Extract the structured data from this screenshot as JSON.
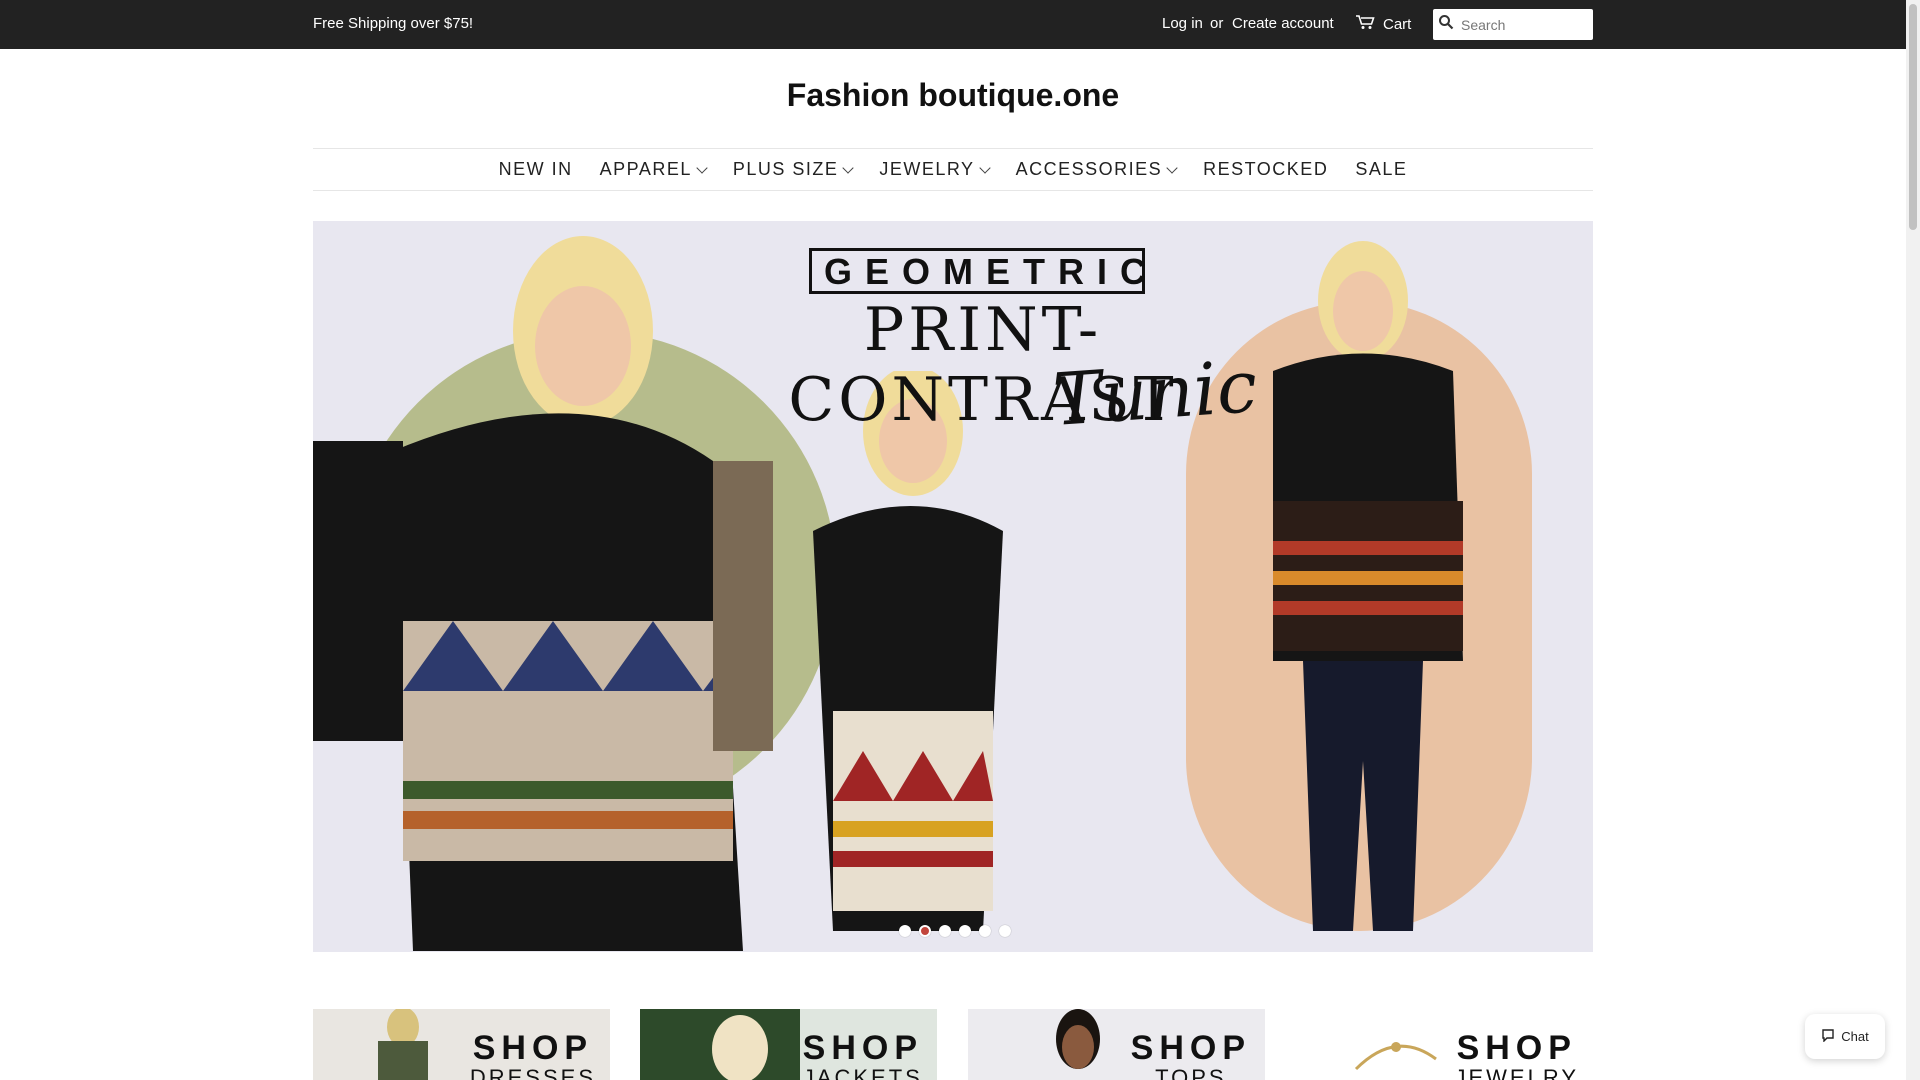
{
  "topbar": {
    "promo": "Free Shipping over $75!",
    "login": "Log in",
    "or": "or",
    "create_account": "Create account",
    "cart": "Cart",
    "search_placeholder": "Search"
  },
  "logo": "Fashion boutique.one",
  "nav": [
    {
      "label": "NEW IN",
      "dropdown": false
    },
    {
      "label": "APPAREL",
      "dropdown": true
    },
    {
      "label": "PLUS SIZE",
      "dropdown": true
    },
    {
      "label": "JEWELRY",
      "dropdown": true
    },
    {
      "label": "ACCESSORIES",
      "dropdown": true
    },
    {
      "label": "RESTOCKED",
      "dropdown": false
    },
    {
      "label": "SALE",
      "dropdown": false
    }
  ],
  "hero": {
    "line1": "GEOMETRIC",
    "line2": "PRINT-CONTRAST",
    "line3": "Tunic",
    "slide_count": 6,
    "active_slide": 2
  },
  "tiles": [
    {
      "line1": "SHOP",
      "line2": "DRESSES"
    },
    {
      "line1": "SHOP",
      "line2": "JACKETS"
    },
    {
      "line1": "SHOP",
      "line2": "TOPS"
    },
    {
      "line1": "SHOP",
      "line2": "JEWELRY"
    }
  ],
  "chat": {
    "label": "Chat"
  },
  "colors": {
    "topbar": "#222222",
    "hero_bg": "#e8e7f0",
    "circle_green": "#b6bc8c",
    "pill_peach": "#e9c2a3",
    "active_dot": "#c2453c"
  }
}
